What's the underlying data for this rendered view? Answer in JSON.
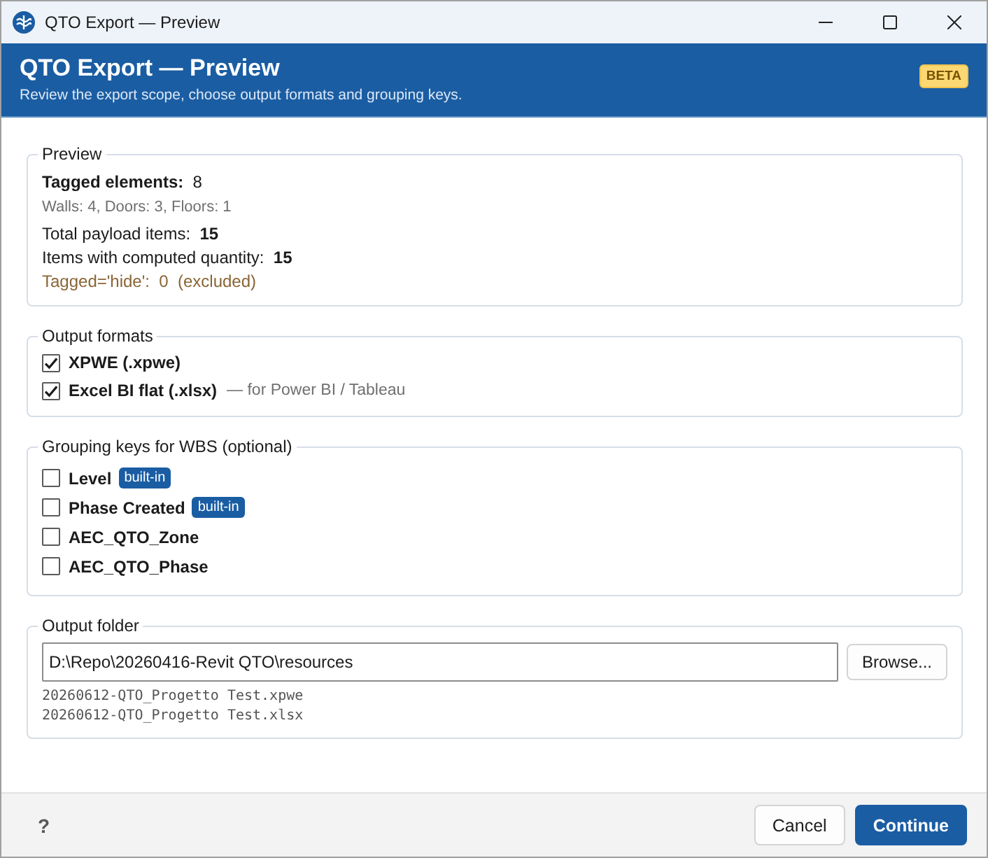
{
  "window": {
    "title": "QTO Export — Preview"
  },
  "header": {
    "title": "QTO Export — Preview",
    "subtitle": "Review the export scope, choose output formats and grouping keys.",
    "badge": "BETA"
  },
  "preview": {
    "legend": "Preview",
    "lines": [
      {
        "kind": "heading",
        "text": "**Tagged elements:**  8"
      },
      {
        "kind": "breakdown",
        "text": "Walls: 4, Doors: 3, Floors: 1"
      },
      {
        "kind": "count",
        "text": "Total payload items:  **15**"
      },
      {
        "kind": "count",
        "text": "Items with computed quantity:  **15**"
      },
      {
        "kind": "excluded",
        "text": "Tagged='hide':  0  (excluded)"
      }
    ]
  },
  "output_formats": {
    "legend": "Output formats",
    "items": [
      {
        "label": "XPWE (.xpwe)",
        "checked": true
      },
      {
        "label": "Excel BI flat (.xlsx)",
        "checked": true,
        "note": "— for Power BI / Tableau"
      }
    ]
  },
  "grouping_keys": {
    "legend": "Grouping keys for WBS (optional)",
    "items": [
      {
        "label": "Level",
        "checked": false,
        "badge": "built-in"
      },
      {
        "label": "Phase Created",
        "checked": false,
        "badge": "built-in"
      },
      {
        "label": "AEC_QTO_Zone",
        "checked": false
      },
      {
        "label": "AEC_QTO_Phase",
        "checked": false
      }
    ]
  },
  "output_folder": {
    "legend": "Output folder",
    "path": "D:\\Repo\\20260416-Revit QTO\\resources",
    "browse": "Browse...",
    "files": [
      "20260612-QTO_Progetto Test.xpwe",
      "20260612-QTO_Progetto Test.xlsx"
    ]
  },
  "footer": {
    "help": "?",
    "buttons": [
      {
        "label": "Cancel",
        "kind": "secondary"
      },
      {
        "label": "Continue",
        "kind": "primary"
      }
    ]
  }
}
